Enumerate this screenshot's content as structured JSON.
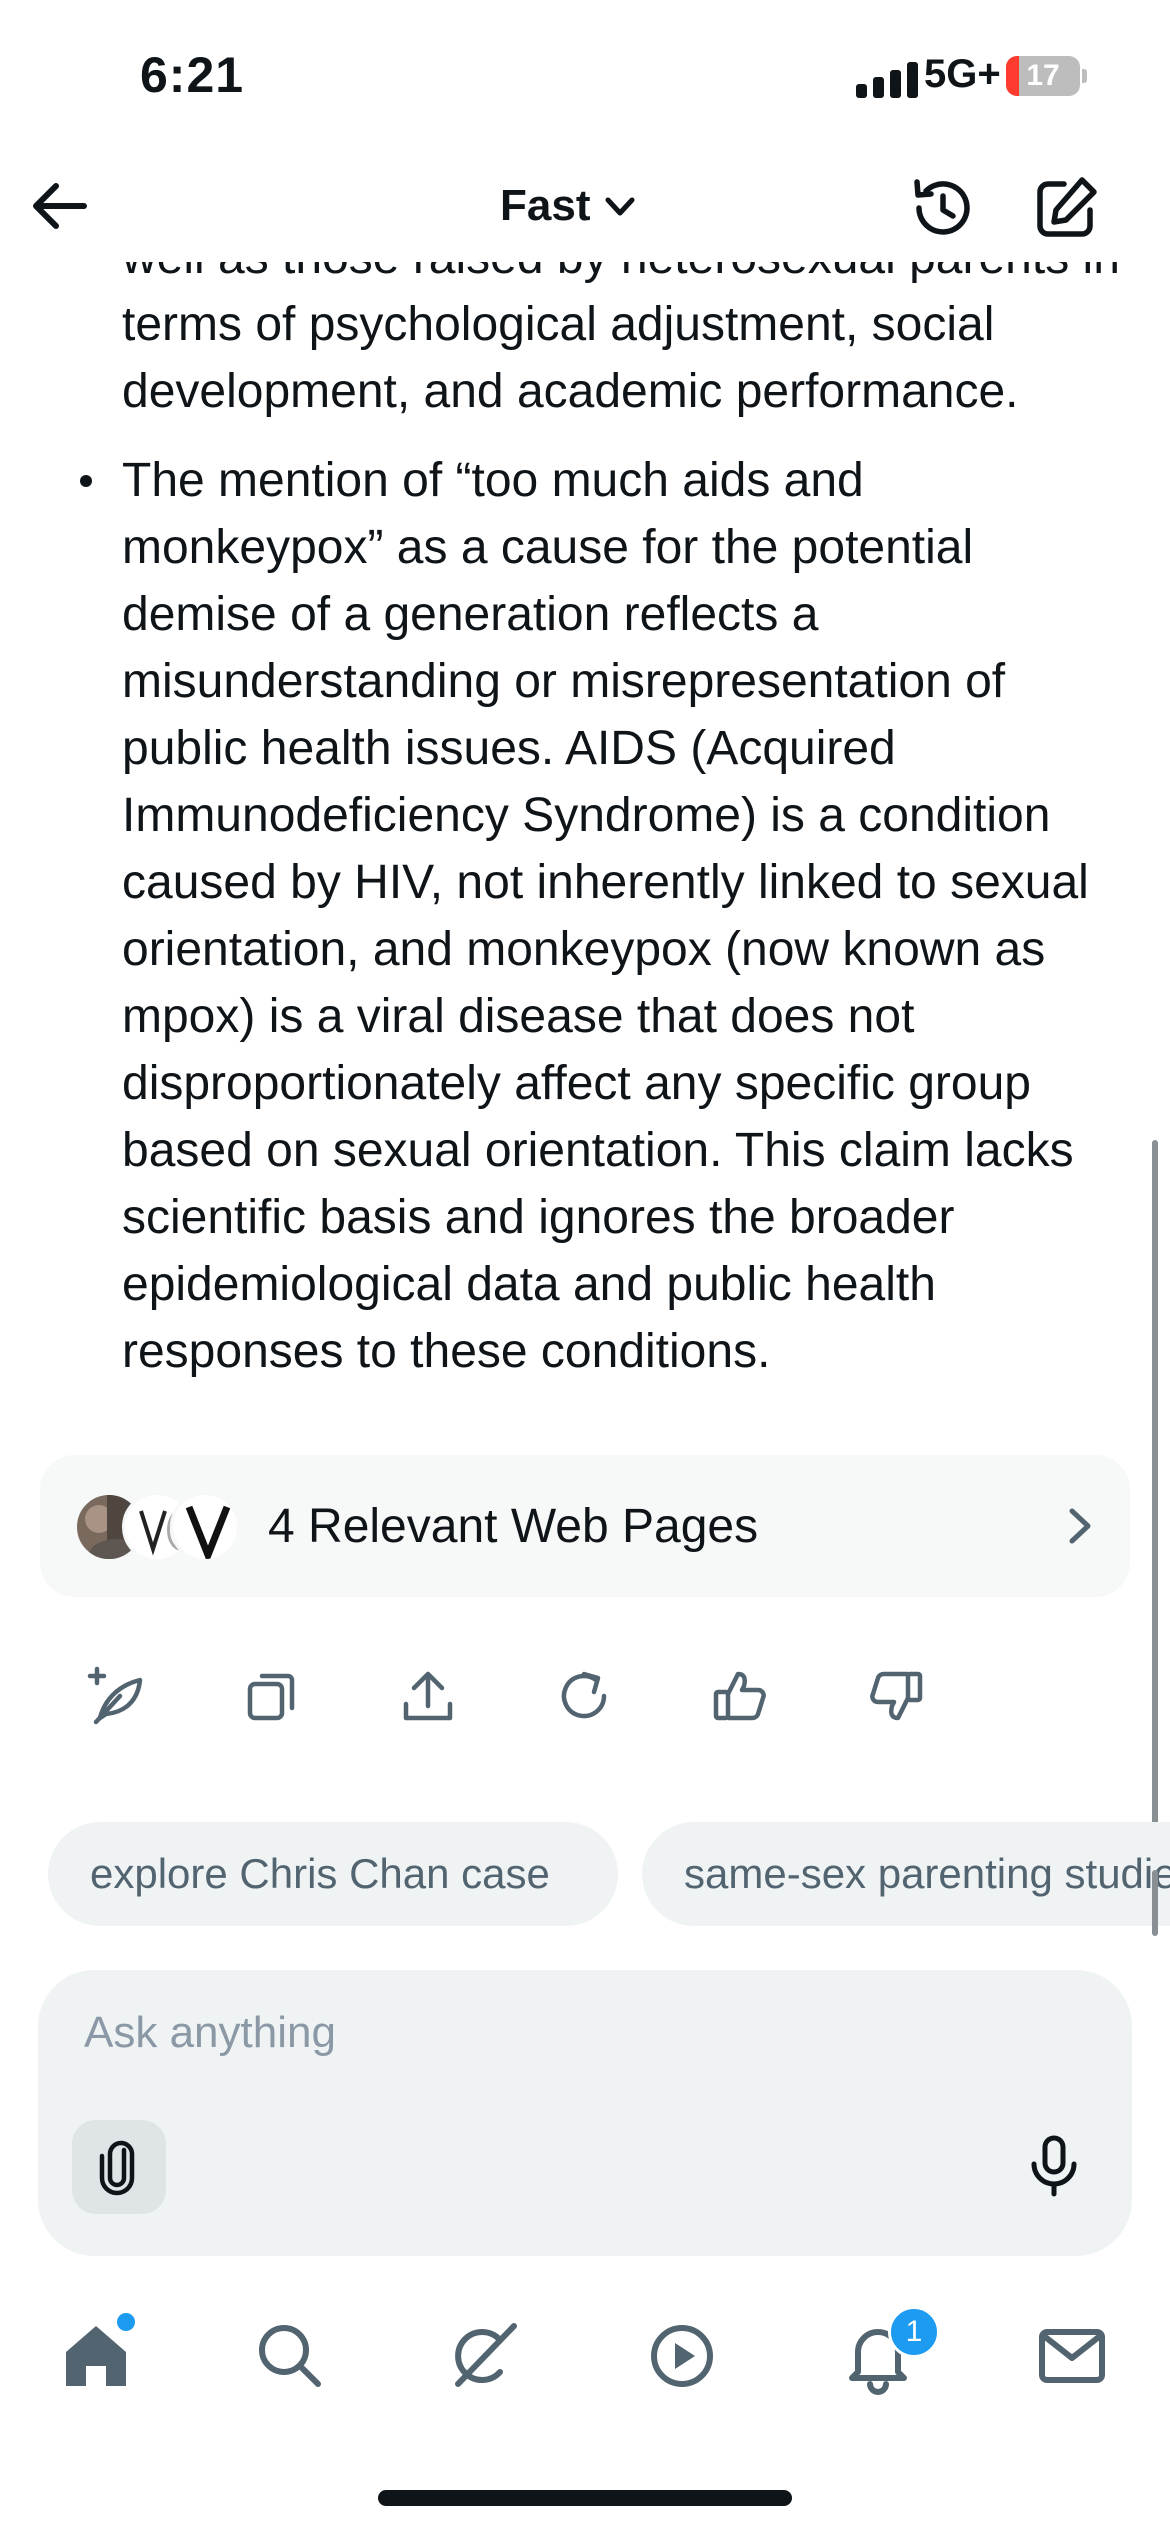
{
  "status_bar": {
    "time": "6:21",
    "network": "5G+",
    "battery": "17"
  },
  "header": {
    "model_label": "Fast",
    "icons": [
      "back-arrow-icon",
      "chevron-down-icon",
      "history-icon",
      "compose-icon"
    ]
  },
  "content": {
    "partial_paragraph": "well as those raised by heterosexual parents in terms of psychological adjustment, social development, and academic performance.",
    "bullet_text": "The mention of “too much aids and monkeypox” as a cause for the potential demise of a generation reflects a misunderstanding or misrepresentation of public health issues. AIDS (Acquired Immunodeficiency Syndrome) is a condition caused by HIV, not inherently linked to sexual orientation, and monkeypox (now known as mpox) is a viral disease that does not disproportionately affect any specific group based on sexual orientation. This claim lacks scientific basis and ignores the broader epidemiological data and public health responses to these conditions."
  },
  "sources": {
    "label": "4 Relevant Web Pages"
  },
  "actions": [
    "post-icon",
    "copy-icon",
    "share-icon",
    "regenerate-icon",
    "thumbs-up-icon",
    "thumbs-down-icon"
  ],
  "suggestions": [
    {
      "label": "explore Chris Chan case"
    },
    {
      "label": "same-sex parenting studies"
    }
  ],
  "composer": {
    "placeholder": "Ask anything"
  },
  "bottom_nav": {
    "items": [
      "home-icon",
      "search-icon",
      "grok-icon",
      "play-icon",
      "notifications-icon",
      "messages-icon"
    ],
    "notifications_count": "1"
  },
  "colors": {
    "accent": "#1d9bf0",
    "text": "#0f1419",
    "muted": "#536471",
    "chip_bg": "#eff3f4",
    "battery_low": "#ff3b30"
  }
}
